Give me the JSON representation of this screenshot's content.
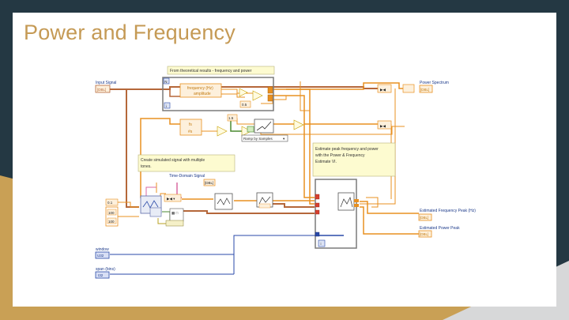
{
  "slide": {
    "title": "Power and Frequency"
  },
  "diagram": {
    "comments": {
      "theoretical": "From theoretical results - frequency and power",
      "simulated_line1": "Create simulated signal with multiple",
      "simulated_line2": "tones.",
      "estimate_line1": "Estimate peak frequency and power",
      "estimate_line2": "with the Power & Frequency",
      "estimate_line3": "Estimate VI."
    },
    "labels": {
      "input_signal": "Input Signal",
      "frequency": "frequency (Hz)",
      "amplitude": "amplitude",
      "power_spectrum": "Power Spectrum",
      "fs": "fs",
      "samples": "#s",
      "ramp_by_samples": "Ramp by Samples",
      "time_domain_signal": "Time-Domain Signal",
      "estimated_frequency_peak": "Estimated Frequency Peak (Hz)",
      "estimated_power_peak": "Estimated Power Peak",
      "window": "window",
      "span_bins": "span (bins)"
    },
    "constants": {
      "half": "0.5",
      "one_five": "1.5",
      "zero_one": "0.1",
      "hundred_a": "100",
      "hundred_b": "100"
    },
    "terminals": {
      "input_signal_type": "[DBL]",
      "power_spectrum_type": "[DBL]",
      "time_domain_type": "[DBL]",
      "freq_peak_type": "[DBL]",
      "power_peak_type": "[DBL]",
      "window_type": "U32",
      "span_type": "I32",
      "loop_index": "i"
    }
  }
}
